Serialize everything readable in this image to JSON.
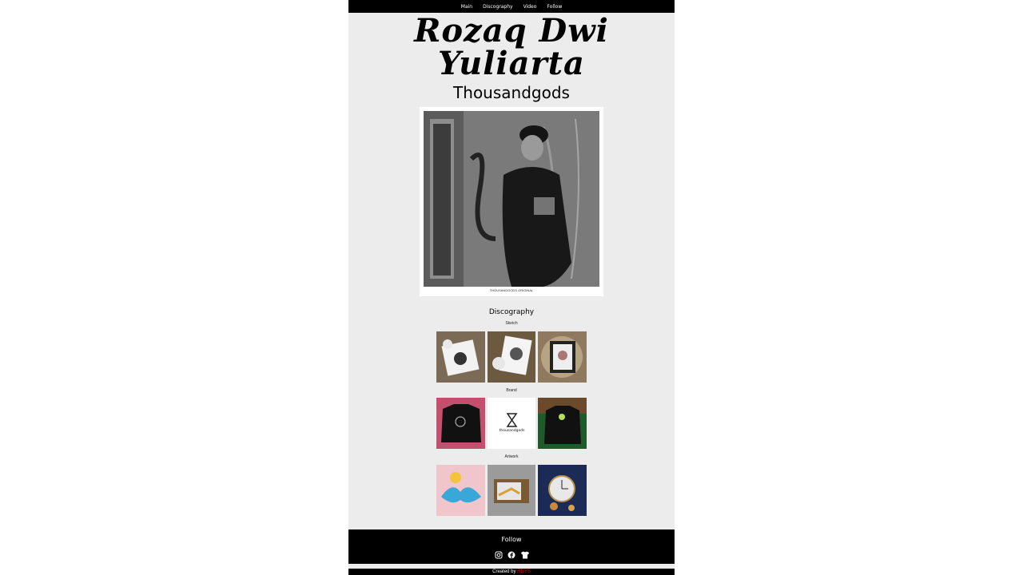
{
  "nav": {
    "items": [
      "Main",
      "Discography",
      "Video",
      "Follow"
    ]
  },
  "header": {
    "title": "Rozaq Dwi Yuliarta",
    "subtitle": "Thousandgods"
  },
  "photo": {
    "caption": "THOUSANDGODS ORIGINAL"
  },
  "discography": {
    "heading": "Discography",
    "categories": [
      {
        "label": "Sketch"
      },
      {
        "label": "Brand"
      },
      {
        "label": "Artwork"
      }
    ],
    "brand_logo_text": "thousandgods"
  },
  "footer": {
    "title": "Follow",
    "social_icons": [
      "instagram-icon",
      "facebook-icon",
      "tshirt-icon"
    ]
  },
  "credit": {
    "prefix": "Created by",
    "brand": "RDYS"
  },
  "colors": {
    "page_background": "#ececec",
    "bar": "#000000",
    "credit_accent": "#dd1111"
  }
}
